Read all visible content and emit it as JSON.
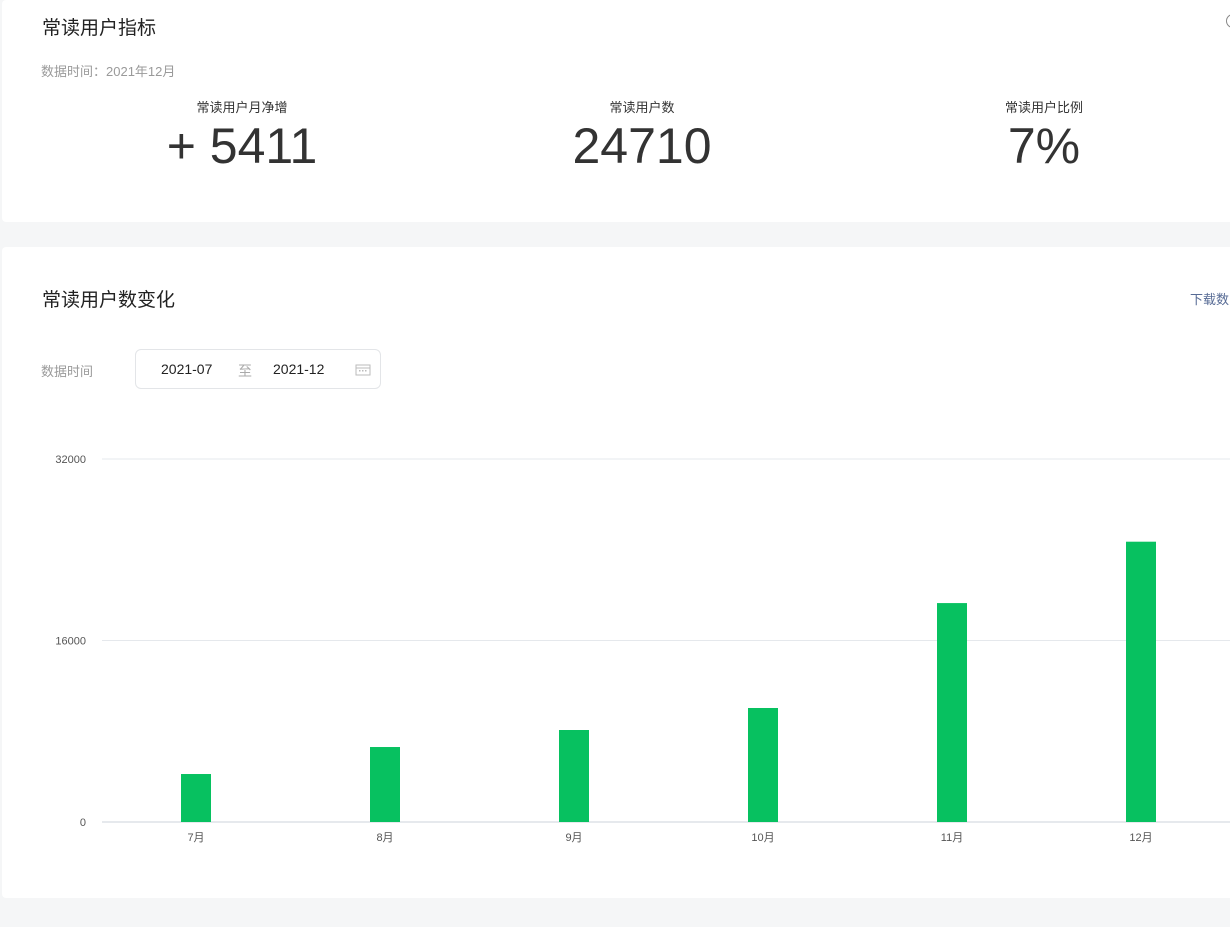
{
  "summary": {
    "title": "常读用户指标",
    "data_time": "数据时间：2021年12月",
    "metrics": [
      {
        "label": "常读用户月净增",
        "value": "+ 5411"
      },
      {
        "label": "常读用户数",
        "value": "24710"
      },
      {
        "label": "常读用户比例",
        "value": "7%"
      }
    ]
  },
  "trend": {
    "title": "常读用户数变化",
    "download_label": "下载数",
    "filter_label": "数据时间",
    "start": "2021-07",
    "separator": "至",
    "end": "2021-12"
  },
  "colors": {
    "bar": "#07c160",
    "grid": "#e5e8ec"
  },
  "chart_data": {
    "type": "bar",
    "categories": [
      "7月",
      "8月",
      "9月",
      "10月",
      "11月",
      "12月"
    ],
    "values": [
      4230,
      6610,
      8110,
      10050,
      19299,
      24710
    ],
    "yticks": [
      "0",
      "16000",
      "32000"
    ],
    "ylim": [
      0,
      32000
    ],
    "xlabel": "",
    "ylabel": "",
    "title": ""
  }
}
